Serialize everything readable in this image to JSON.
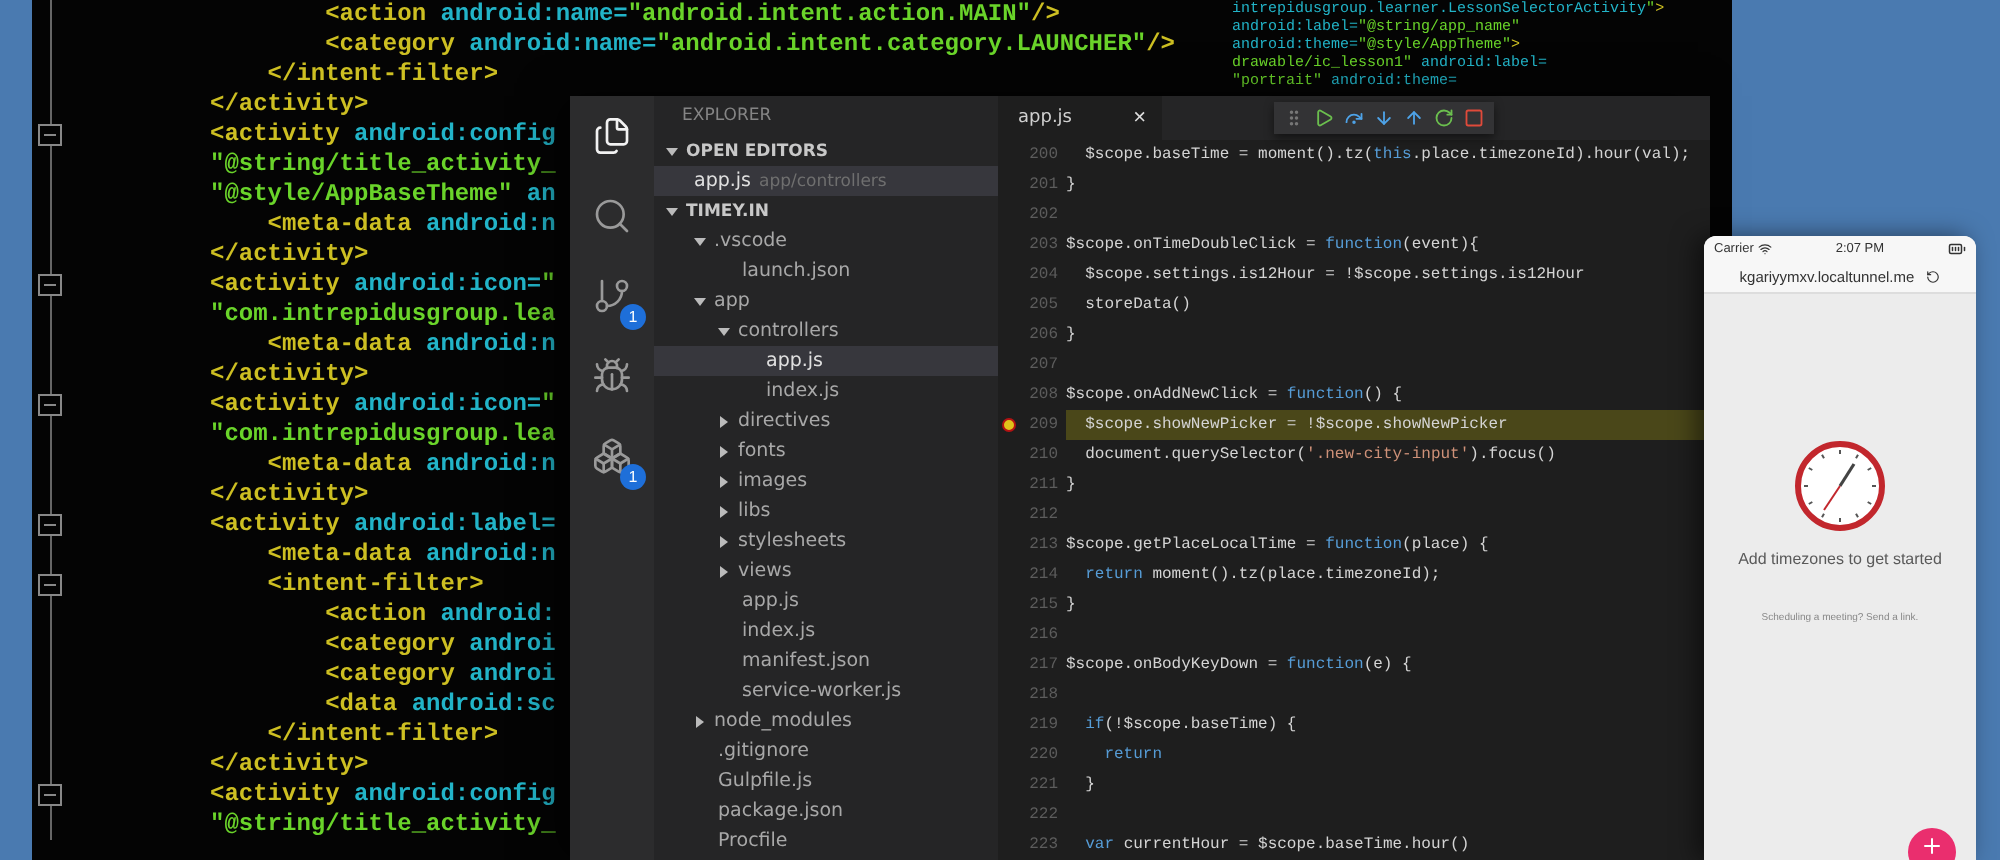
{
  "back_editor": {
    "lines": [
      {
        "fold": false,
        "segments": [
          {
            "kind": "tag",
            "text": "        <action"
          },
          {
            "kind": "attr",
            "text": " android:name="
          },
          {
            "kind": "string",
            "text": "\"android.intent.action.MAIN\""
          },
          {
            "kind": "tag",
            "text": "/>"
          }
        ]
      },
      {
        "fold": false,
        "segments": [
          {
            "kind": "tag",
            "text": "        <category"
          },
          {
            "kind": "attr",
            "text": " android:name="
          },
          {
            "kind": "string",
            "text": "\"android.intent.category.LAUNCHER\""
          },
          {
            "kind": "tag",
            "text": "/>"
          }
        ]
      },
      {
        "fold": false,
        "segments": [
          {
            "kind": "tag",
            "text": "    </intent-filter>"
          }
        ]
      },
      {
        "fold": false,
        "segments": [
          {
            "kind": "tag",
            "text": "</activity>"
          }
        ]
      },
      {
        "fold": true,
        "segments": [
          {
            "kind": "tag",
            "text": "<activity"
          },
          {
            "kind": "attr",
            "text": " android:config"
          }
        ]
      },
      {
        "fold": false,
        "segments": [
          {
            "kind": "string",
            "text": "\"@string/title_activity_"
          }
        ]
      },
      {
        "fold": false,
        "segments": [
          {
            "kind": "string",
            "text": "\"@style/AppBaseTheme\""
          },
          {
            "kind": "attr",
            "text": " an"
          }
        ]
      },
      {
        "fold": false,
        "segments": [
          {
            "kind": "tag",
            "text": "    <meta-data"
          },
          {
            "kind": "attr",
            "text": " android:n"
          }
        ]
      },
      {
        "fold": false,
        "segments": [
          {
            "kind": "tag",
            "text": "</activity>"
          }
        ]
      },
      {
        "fold": true,
        "segments": [
          {
            "kind": "tag",
            "text": "<activity"
          },
          {
            "kind": "attr",
            "text": " android:icon="
          },
          {
            "kind": "string",
            "text": "\""
          }
        ]
      },
      {
        "fold": false,
        "segments": [
          {
            "kind": "string",
            "text": "\"com.intrepidusgroup.lea"
          }
        ]
      },
      {
        "fold": false,
        "segments": [
          {
            "kind": "tag",
            "text": "    <meta-data"
          },
          {
            "kind": "attr",
            "text": " android:n"
          }
        ]
      },
      {
        "fold": false,
        "segments": [
          {
            "kind": "tag",
            "text": "</activity>"
          }
        ]
      },
      {
        "fold": true,
        "segments": [
          {
            "kind": "tag",
            "text": "<activity"
          },
          {
            "kind": "attr",
            "text": " android:icon="
          },
          {
            "kind": "string",
            "text": "\""
          }
        ]
      },
      {
        "fold": false,
        "segments": [
          {
            "kind": "string",
            "text": "\"com.intrepidusgroup.lea"
          }
        ]
      },
      {
        "fold": false,
        "segments": [
          {
            "kind": "tag",
            "text": "    <meta-data"
          },
          {
            "kind": "attr",
            "text": " android:n"
          }
        ]
      },
      {
        "fold": false,
        "segments": [
          {
            "kind": "tag",
            "text": "</activity>"
          }
        ]
      },
      {
        "fold": true,
        "segments": [
          {
            "kind": "tag",
            "text": "<activity"
          },
          {
            "kind": "attr",
            "text": " android:label="
          }
        ]
      },
      {
        "fold": false,
        "segments": [
          {
            "kind": "tag",
            "text": "    <meta-data"
          },
          {
            "kind": "attr",
            "text": " android:n"
          }
        ]
      },
      {
        "fold": true,
        "segments": [
          {
            "kind": "tag",
            "text": "    <intent-filter>"
          }
        ]
      },
      {
        "fold": false,
        "segments": [
          {
            "kind": "tag",
            "text": "        <action"
          },
          {
            "kind": "attr",
            "text": " android:"
          }
        ]
      },
      {
        "fold": false,
        "segments": [
          {
            "kind": "tag",
            "text": "        <category"
          },
          {
            "kind": "attr",
            "text": " androi"
          }
        ]
      },
      {
        "fold": false,
        "segments": [
          {
            "kind": "tag",
            "text": "        <category"
          },
          {
            "kind": "attr",
            "text": " androi"
          }
        ]
      },
      {
        "fold": false,
        "segments": [
          {
            "kind": "tag",
            "text": "        <data"
          },
          {
            "kind": "attr",
            "text": " android:sc"
          }
        ]
      },
      {
        "fold": false,
        "segments": [
          {
            "kind": "tag",
            "text": "    </intent-filter>"
          }
        ]
      },
      {
        "fold": false,
        "segments": [
          {
            "kind": "tag",
            "text": "</activity>"
          }
        ]
      },
      {
        "fold": true,
        "segments": [
          {
            "kind": "tag",
            "text": "<activity"
          },
          {
            "kind": "attr",
            "text": " android:config"
          }
        ]
      },
      {
        "fold": false,
        "segments": [
          {
            "kind": "string",
            "text": "\"@string/title_activity_"
          }
        ]
      }
    ],
    "fragments": [
      {
        "segments": [
          {
            "kind": "attr",
            "text": "intrepidusgroup.learner.LessonSelectorActivity"
          },
          {
            "kind": "string",
            "text": "\""
          },
          {
            "kind": "tag",
            "text": ">"
          }
        ]
      },
      {
        "segments": [
          {
            "kind": "attr",
            "text": "android:label="
          },
          {
            "kind": "string",
            "text": "\"@string/app_name\""
          }
        ]
      },
      {
        "segments": [
          {
            "kind": "attr",
            "text": "android:theme="
          },
          {
            "kind": "string",
            "text": "\"@style/AppTheme\""
          },
          {
            "kind": "tag",
            "text": ">"
          }
        ]
      },
      {
        "segments": [
          {
            "kind": "string",
            "text": "drawable/ic_lesson1\""
          },
          {
            "kind": "attr",
            "text": " android:label="
          }
        ]
      },
      {
        "segments": [
          {
            "kind": "string",
            "text": "\"portrait\""
          },
          {
            "kind": "attr",
            "text": " android:theme="
          }
        ]
      }
    ]
  },
  "vscode": {
    "activity_bar": [
      {
        "kind": "files",
        "selected": true
      },
      {
        "kind": "search",
        "selected": false
      },
      {
        "kind": "git",
        "selected": false,
        "badge": "1"
      },
      {
        "kind": "debug",
        "selected": false
      },
      {
        "kind": "extensions",
        "selected": false,
        "badge": "1"
      }
    ],
    "explorer": {
      "title": "EXPLORER",
      "open_editors": {
        "title": "OPEN EDITORS",
        "expanded": true,
        "items": [
          {
            "name": "app.js",
            "path": "app/controllers",
            "selected": true
          }
        ]
      },
      "project": {
        "title": "TIMEY.IN",
        "expanded": true,
        "items": [
          {
            "name": ".vscode",
            "expanded": true,
            "selected": false,
            "children": [
              {
                "name": "launch.json",
                "selected": false
              }
            ]
          },
          {
            "name": "app",
            "expanded": true,
            "selected": false,
            "children": [
              {
                "name": "controllers",
                "expanded": true,
                "selected": false,
                "children": [
                  {
                    "name": "app.js",
                    "selected": true
                  },
                  {
                    "name": "index.js",
                    "selected": false
                  }
                ]
              },
              {
                "name": "directives",
                "expanded": false,
                "selected": false
              },
              {
                "name": "fonts",
                "expanded": false,
                "selected": false
              },
              {
                "name": "images",
                "expanded": false,
                "selected": false
              },
              {
                "name": "libs",
                "expanded": false,
                "selected": false
              },
              {
                "name": "stylesheets",
                "expanded": false,
                "selected": false
              },
              {
                "name": "views",
                "expanded": false,
                "selected": false
              },
              {
                "name": "app.js",
                "selected": false
              },
              {
                "name": "index.js",
                "selected": false
              },
              {
                "name": "manifest.json",
                "selected": false
              },
              {
                "name": "service-worker.js",
                "selected": false
              }
            ]
          },
          {
            "name": "node_modules",
            "expanded": false,
            "selected": false
          },
          {
            "name": ".gitignore",
            "selected": false
          },
          {
            "name": "Gulpfile.js",
            "selected": false
          },
          {
            "name": "package.json",
            "selected": false
          },
          {
            "name": "Procfile",
            "selected": false
          }
        ]
      }
    },
    "tab": {
      "label": "app.js",
      "close": "×"
    },
    "editor": {
      "lines": [
        {
          "number": "200",
          "breakpoint": false,
          "highlighted": false,
          "segments": [
            {
              "kind": "plain",
              "text": "  $scope.baseTime = moment().tz("
            },
            {
              "kind": "keyword",
              "text": "this"
            },
            {
              "kind": "plain",
              "text": ".place.timezoneId).hour(val);"
            }
          ]
        },
        {
          "number": "201",
          "breakpoint": false,
          "highlighted": false,
          "segments": [
            {
              "kind": "plain",
              "text": "}"
            }
          ]
        },
        {
          "number": "202",
          "breakpoint": false,
          "highlighted": false
        },
        {
          "number": "203",
          "breakpoint": false,
          "highlighted": false,
          "segments": [
            {
              "kind": "plain",
              "text": "$scope.onTimeDoubleClick = "
            },
            {
              "kind": "keyword",
              "text": "function"
            },
            {
              "kind": "plain",
              "text": "(event){"
            }
          ]
        },
        {
          "number": "204",
          "breakpoint": false,
          "highlighted": false,
          "segments": [
            {
              "kind": "plain",
              "text": "  $scope.settings.is12Hour = !$scope.settings.is12Hour"
            }
          ]
        },
        {
          "number": "205",
          "breakpoint": false,
          "highlighted": false,
          "segments": [
            {
              "kind": "plain",
              "text": "  storeData()"
            }
          ]
        },
        {
          "number": "206",
          "breakpoint": false,
          "highlighted": false,
          "segments": [
            {
              "kind": "plain",
              "text": "}"
            }
          ]
        },
        {
          "number": "207",
          "breakpoint": false,
          "highlighted": false
        },
        {
          "number": "208",
          "breakpoint": false,
          "highlighted": false,
          "segments": [
            {
              "kind": "plain",
              "text": "$scope.onAddNewClick = "
            },
            {
              "kind": "keyword",
              "text": "function"
            },
            {
              "kind": "plain",
              "text": "() {"
            }
          ]
        },
        {
          "number": "209",
          "breakpoint": true,
          "highlighted": true,
          "segments": [
            {
              "kind": "plain",
              "text": "  $scope.showNewPicker = !$scope.showNewPicker"
            }
          ]
        },
        {
          "number": "210",
          "breakpoint": false,
          "highlighted": false,
          "segments": [
            {
              "kind": "plain",
              "text": "  document.querySelector("
            },
            {
              "kind": "string",
              "text": "'.new-city-input'"
            },
            {
              "kind": "plain",
              "text": ").focus()"
            }
          ]
        },
        {
          "number": "211",
          "breakpoint": false,
          "highlighted": false,
          "segments": [
            {
              "kind": "plain",
              "text": "}"
            }
          ]
        },
        {
          "number": "212",
          "breakpoint": false,
          "highlighted": false
        },
        {
          "number": "213",
          "breakpoint": false,
          "highlighted": false,
          "segments": [
            {
              "kind": "plain",
              "text": "$scope.getPlaceLocalTime = "
            },
            {
              "kind": "keyword",
              "text": "function"
            },
            {
              "kind": "plain",
              "text": "(place) {"
            }
          ]
        },
        {
          "number": "214",
          "breakpoint": false,
          "highlighted": false,
          "segments": [
            {
              "kind": "keyword",
              "text": "  return"
            },
            {
              "kind": "plain",
              "text": " moment().tz(place.timezoneId);"
            }
          ]
        },
        {
          "number": "215",
          "breakpoint": false,
          "highlighted": false,
          "segments": [
            {
              "kind": "plain",
              "text": "}"
            }
          ]
        },
        {
          "number": "216",
          "breakpoint": false,
          "highlighted": false
        },
        {
          "number": "217",
          "breakpoint": false,
          "highlighted": false,
          "segments": [
            {
              "kind": "plain",
              "text": "$scope.onBodyKeyDown = "
            },
            {
              "kind": "keyword",
              "text": "function"
            },
            {
              "kind": "plain",
              "text": "(e) {"
            }
          ]
        },
        {
          "number": "218",
          "breakpoint": false,
          "highlighted": false
        },
        {
          "number": "219",
          "breakpoint": false,
          "highlighted": false,
          "segments": [
            {
              "kind": "keyword",
              "text": "  if"
            },
            {
              "kind": "plain",
              "text": "(!$scope.baseTime) {"
            }
          ]
        },
        {
          "number": "220",
          "breakpoint": false,
          "highlighted": false,
          "segments": [
            {
              "kind": "keyword",
              "text": "    return"
            }
          ]
        },
        {
          "number": "221",
          "breakpoint": false,
          "highlighted": false,
          "segments": [
            {
              "kind": "plain",
              "text": "  }"
            }
          ]
        },
        {
          "number": "222",
          "breakpoint": false,
          "highlighted": false
        },
        {
          "number": "223",
          "breakpoint": false,
          "highlighted": false,
          "segments": [
            {
              "kind": "keyword",
              "text": "  var"
            },
            {
              "kind": "plain",
              "text": " currentHour = $scope.baseTime.hour()"
            }
          ]
        }
      ]
    }
  },
  "phone": {
    "carrier": "Carrier",
    "time": "2:07 PM",
    "url": "kgariyymxv.localtunnel.me",
    "empty_title": "Add timezones to get started",
    "empty_hint": "Scheduling a meeting? Send a link."
  }
}
